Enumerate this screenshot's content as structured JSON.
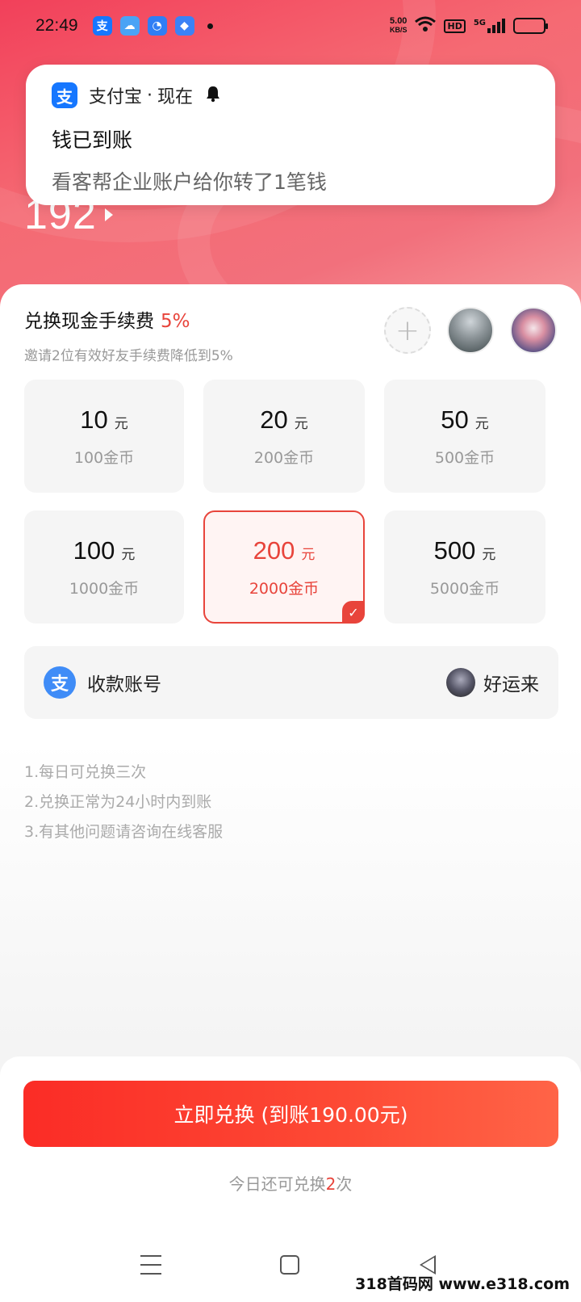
{
  "status_bar": {
    "time": "22:49",
    "net_speed_value": "5.00",
    "net_speed_unit": "KB/S",
    "hd": "HD",
    "signal": "5G"
  },
  "notification": {
    "app": "支付宝",
    "separator": "·",
    "when": "现在",
    "title": "钱已到账",
    "body": "看客帮企业账户给你转了1笔钱"
  },
  "balance": "192",
  "fee": {
    "title": "兑换现金手续费",
    "percent": "5%",
    "subtitle": "邀请2位有效好友手续费降低到5%"
  },
  "options": [
    {
      "amount": "10",
      "unit": "元",
      "coins": "100金币",
      "selected": false
    },
    {
      "amount": "20",
      "unit": "元",
      "coins": "200金币",
      "selected": false
    },
    {
      "amount": "50",
      "unit": "元",
      "coins": "500金币",
      "selected": false
    },
    {
      "amount": "100",
      "unit": "元",
      "coins": "1000金币",
      "selected": false
    },
    {
      "amount": "200",
      "unit": "元",
      "coins": "2000金币",
      "selected": true
    },
    {
      "amount": "500",
      "unit": "元",
      "coins": "5000金币",
      "selected": false
    }
  ],
  "account": {
    "label": "收款账号",
    "name": "好运来"
  },
  "rules": [
    "1.每日可兑换三次",
    "2.兑换正常为24小时内到账",
    "3.有其他问题请咨询在线客服"
  ],
  "cta_label": "立即兑换 (到账190.00元)",
  "remain": {
    "prefix": "今日还可兑换",
    "count": "2",
    "suffix": "次"
  },
  "watermark": "318首码网 www.e318.com",
  "colors": {
    "accent": "#e8443b",
    "alipay_blue": "#1677ff"
  }
}
